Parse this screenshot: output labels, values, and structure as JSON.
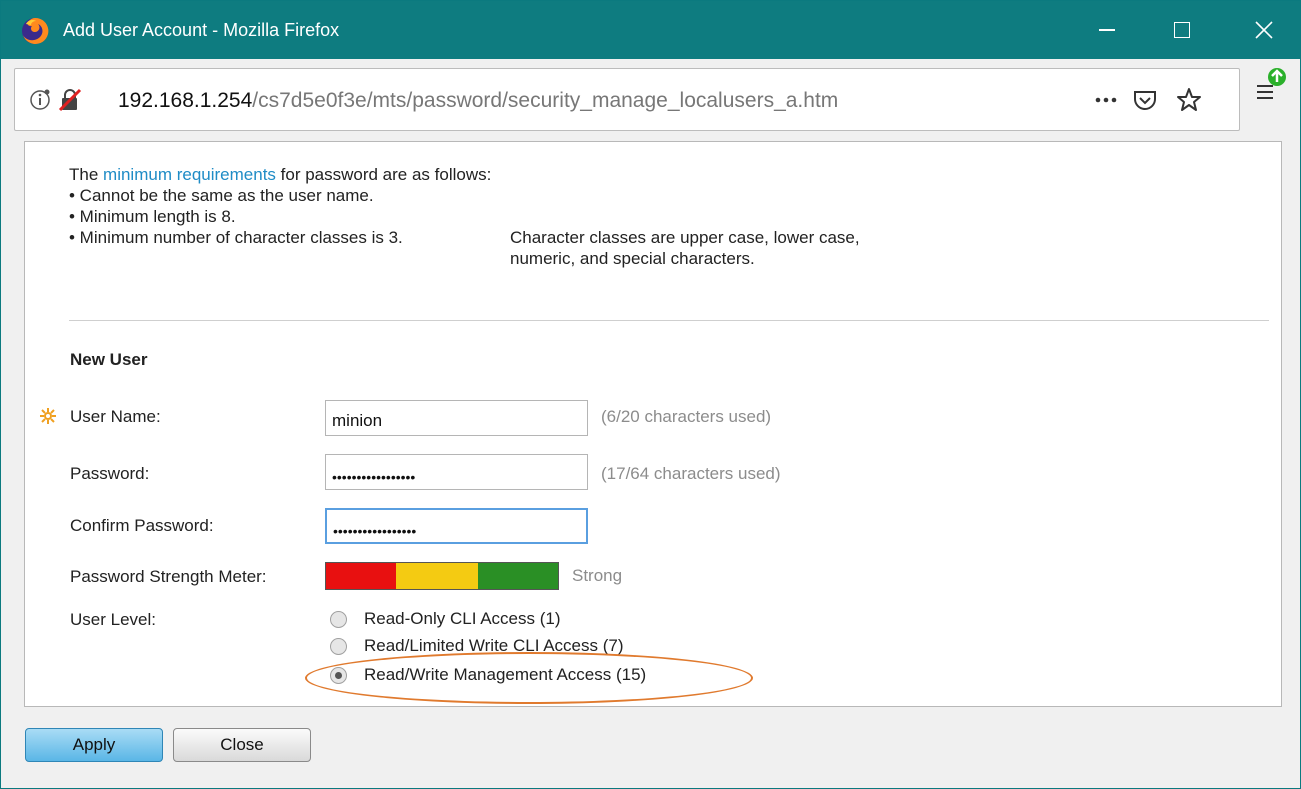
{
  "window": {
    "title": "Add User Account - Mozilla Firefox"
  },
  "urlbar": {
    "host": "192.168.1.254",
    "path": "/cs7d5e0f3e/mts/password/security_manage_localusers_a.htm",
    "more_icon": "ellipsis-icon",
    "pocket_icon": "pocket-icon",
    "bookmark_icon": "star-icon"
  },
  "requirements": {
    "intro_prefix": "The ",
    "intro_link": "minimum requirements",
    "intro_suffix": " for password are as follows:",
    "rule1": "• Cannot be the same as the user name.",
    "rule2": "• Minimum length is 8.",
    "rule3": "• Minimum number of character classes is 3.",
    "note_line1": "Character classes are upper case, lower case,",
    "note_line2": "numeric, and special characters."
  },
  "form": {
    "section_title": "New User",
    "username_label": "User Name:",
    "username_value": "minion",
    "username_hint": "(6/20 characters used)",
    "password_label": "Password:",
    "password_value": "•••••••••••••••••",
    "password_hint": "(17/64 characters used)",
    "confirm_label": "Confirm Password:",
    "confirm_value": "•••••••••••••••••",
    "meter_label": "Password Strength Meter:",
    "meter_text": "Strong",
    "level_label": "User Level:",
    "levels": [
      {
        "label": "Read-Only CLI Access (1)",
        "checked": false
      },
      {
        "label": "Read/Limited Write CLI Access (7)",
        "checked": false
      },
      {
        "label": "Read/Write Management Access (15)",
        "checked": true
      }
    ]
  },
  "buttons": {
    "apply": "Apply",
    "close": "Close"
  },
  "colors": {
    "titlebar": "#0e7c80",
    "link": "#1f8cc6",
    "meter_red": "#e81010",
    "meter_yellow": "#f4cb12",
    "meter_green": "#2a8f25",
    "highlight": "#e07a2e"
  }
}
